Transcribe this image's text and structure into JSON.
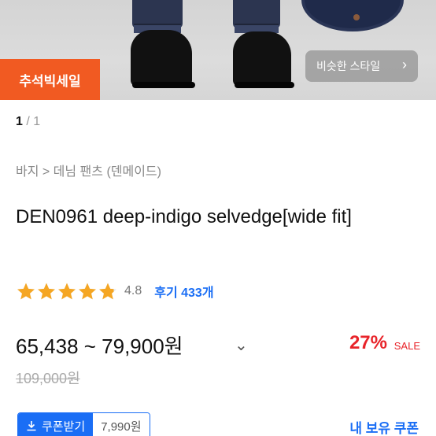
{
  "hero": {
    "sale_badge": "추석빅세일",
    "similar_style_button": "비슷한 스타일",
    "similar_chevron": "›"
  },
  "pager": {
    "current": "1",
    "separator": "/",
    "total": "1"
  },
  "breadcrumb": "바지 > 데님 팬츠 (덴메이드)",
  "product": {
    "title": "DEN0961 deep-indigo selvedge[wide fit]",
    "rating": {
      "score": "4.8",
      "stars": 4.8,
      "review_label": "후기 433개"
    },
    "price": "65,438 ~ 79,900원",
    "price_chevron": "⌄",
    "discount": "27%",
    "sale_label": "SALE",
    "original_price": "109,000원"
  },
  "coupon": {
    "get_label": "쿠폰받기",
    "amount": "7,990원",
    "my_coupons": "내 보유 쿠폰"
  },
  "colors": {
    "accent_blue": "#1a6ef5",
    "sale_red": "#e8242a",
    "badge_orange": "#f15a22",
    "star": "#f5a623"
  }
}
